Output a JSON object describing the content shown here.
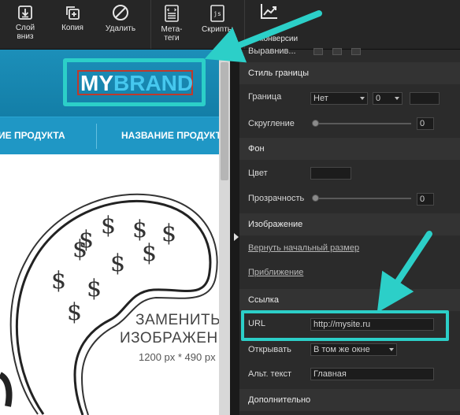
{
  "toolbar": {
    "layer_down": {
      "line1": "Слой",
      "line2": "вниз"
    },
    "copy": "Копия",
    "delete": "Удалить",
    "meta": {
      "line1": "Мета-",
      "line2": "теги"
    },
    "scripts": "Скрипты",
    "conversions": "конверсии"
  },
  "canvas": {
    "logo_my": "MY",
    "logo_brand": "BRAND",
    "nav": [
      "ИЕ ПРОДУКТА",
      "НАЗВАНИЕ ПРОДУКТА"
    ],
    "image_text": [
      "ЗАМЕНИТЬ",
      "ИЗОБРАЖЕН",
      "1200 px * 490 px"
    ]
  },
  "panel": {
    "align_label": "Выравнив...",
    "border_style": {
      "title": "Стиль границы",
      "border_label": "Граница",
      "border_type": "Нет",
      "border_width": "0",
      "rounding_label": "Скругление",
      "rounding_value": "0",
      "rounding_level": 0
    },
    "background": {
      "title": "Фон",
      "color_label": "Цвет",
      "opacity_label": "Прозрачность",
      "opacity_value": "0",
      "opacity_level": 0
    },
    "image": {
      "title": "Изображение",
      "reset_link": "Вернуть начальный размер",
      "zoom_link": "Приближение"
    },
    "link": {
      "title": "Ссылка",
      "url_label": "URL",
      "url_value": "http://mysite.ru",
      "open_label": "Открывать",
      "open_value": "В том же окне",
      "alt_label": "Альт. текст",
      "alt_value": "Главная"
    },
    "more": {
      "title": "Дополнительно"
    }
  },
  "colors": {
    "accent_teal": "#2ccfc8",
    "hero_blue": "#1c8fb9",
    "logo_brand": "#46c8ef",
    "panel_bg": "#2b2b2b"
  }
}
